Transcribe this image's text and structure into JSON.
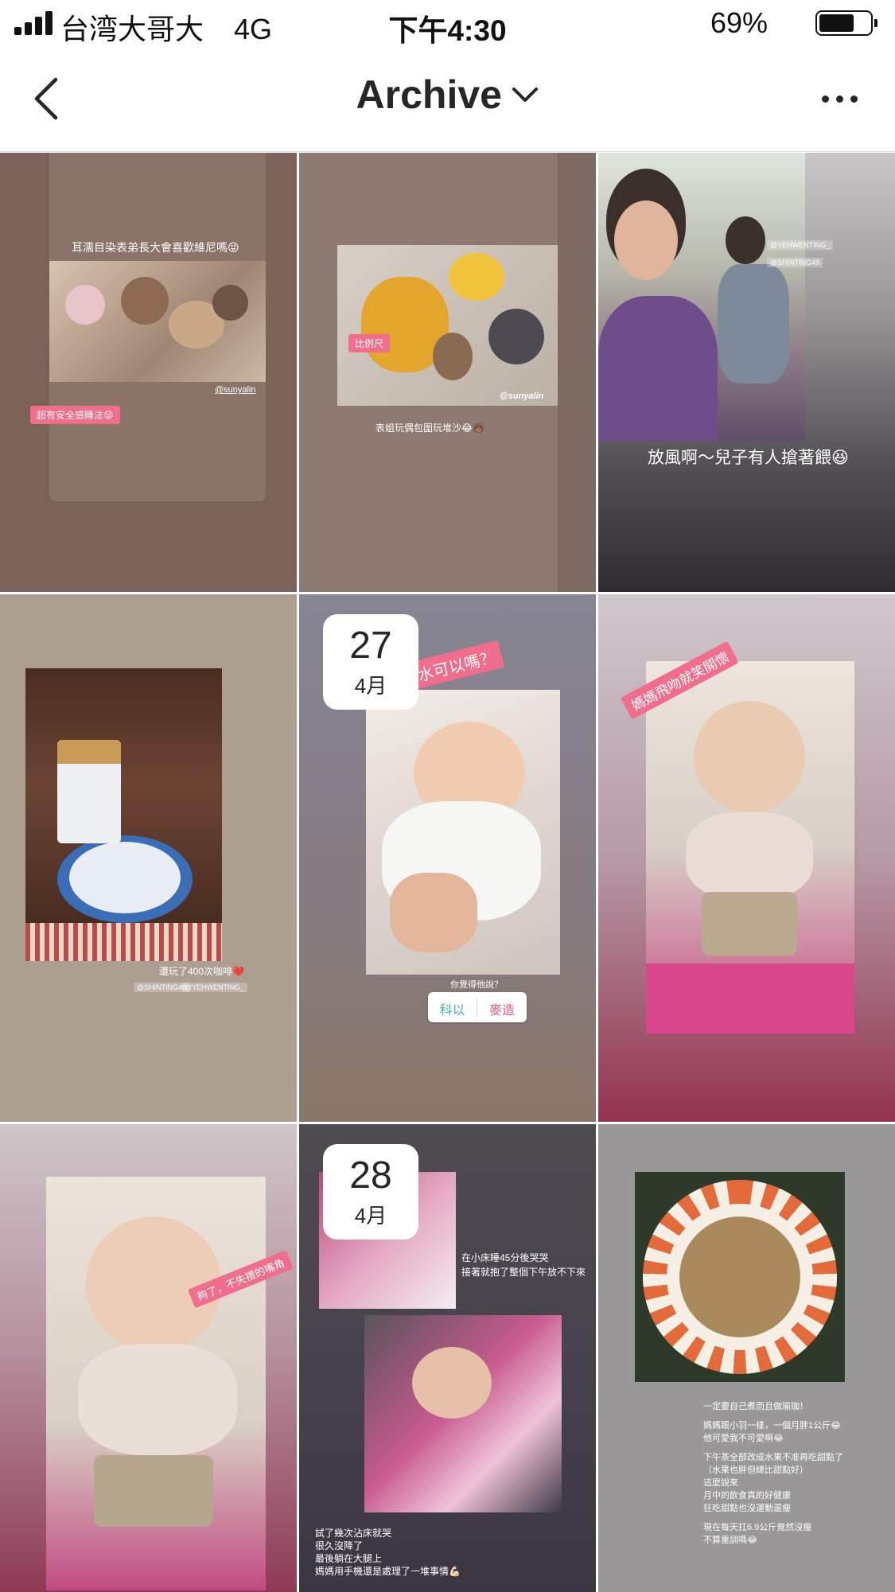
{
  "status_bar": {
    "carrier": "台湾大哥大",
    "network": "4G",
    "time": "下午4:30",
    "battery_pct": "69%",
    "battery_level": 0.69
  },
  "nav": {
    "title": "Archive",
    "back_icon": "chevron-left-icon",
    "title_icon": "chevron-down-icon",
    "more_icon": "ellipsis-icon"
  },
  "stories": [
    {
      "caption": "耳濡目染表弟長大會喜歡維尼嗎😝",
      "tag": "超有安全感睡法😝",
      "handle": "@sunyalin"
    },
    {
      "tag": "比例尺",
      "handle": "@sunyalin",
      "caption": "表姐玩偶包圍玩堆沙😂🐻"
    },
    {
      "caption": "放風啊～兒子有人搶著餵😆",
      "chips": [
        "@YEHWENTING_",
        "@SHINTING48"
      ]
    },
    {
      "caption": "還玩了400次咖啡❤️",
      "chips": [
        "@SHINTING48",
        "@YEHWENTING_"
      ]
    },
    {
      "date_day": "27",
      "date_month": "4月",
      "tag": "媽媽要化妝水可以嗎？",
      "poll_question": "你覺得他說？",
      "poll_options": [
        "科以",
        "麥造"
      ]
    },
    {
      "tag": "媽媽飛吻就笑開懷"
    },
    {
      "tag": "夠了，不失禮的嘴角"
    },
    {
      "date_day": "28",
      "date_month": "4月",
      "caption_top": [
        "在小床睡45分後哭哭",
        "接著就抱了整個下午放不下來"
      ],
      "caption_bottom": [
        "試了幾次沾床就哭",
        "很久沒降了",
        "最後躺在大腿上",
        "媽媽用手機還是處理了一堆事情💪🏻"
      ]
    },
    {
      "caption_lines": [
        "一定要自己煮而且做瑜珈！",
        "",
        "媽媽跟小羽一樣，一個月胖1公斤😂",
        "他可愛我不可愛啊😂",
        "",
        "下午茶全部改成水果不准再吃甜點了",
        "（水果也胖但總比甜點好）",
        "這麼說來",
        "月中的飲食真的好健康",
        "狂吃甜點也沒運動還瘦",
        "",
        "現在每天扛6.9公斤竟然沒瘦",
        "不算重訓嗎😂"
      ]
    }
  ]
}
